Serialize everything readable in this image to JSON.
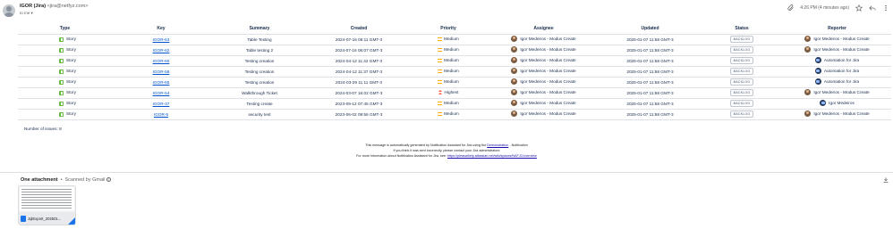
{
  "header": {
    "sender_name": "IGOR (Jira)",
    "sender_email": "<jira@netfyz.com>",
    "recipient": "to me",
    "timestamp": "4:26 PM (4 minutes ago)"
  },
  "table": {
    "columns": [
      "Type",
      "Key",
      "Summary",
      "Created",
      "Priority",
      "Assignee",
      "Updated",
      "Status",
      "Reporter"
    ],
    "rows": [
      {
        "type": "Story",
        "key": "IGOR-63",
        "summary": "Table Testing",
        "created": "2024-07-16 06:11 GMT-3",
        "priority": "Medium",
        "priority_level": "medium",
        "assignee": "Igor Medeiros - Modus Create",
        "updated": "2025-01-07 11:58 GMT-3",
        "status": "BACKLOG",
        "reporter": "Igor Medeiros - Modus Create",
        "reporter_kind": "person"
      },
      {
        "type": "Story",
        "key": "IGOR-62",
        "summary": "Table testing 2",
        "created": "2024-07-16 06:07 GMT-3",
        "priority": "Medium",
        "priority_level": "medium",
        "assignee": "Igor Medeiros - Modus Create",
        "updated": "2025-01-07 11:58 GMT-3",
        "status": "BACKLOG",
        "reporter": "Igor Medeiros - Modus Create",
        "reporter_kind": "person"
      },
      {
        "type": "Story",
        "key": "IGOR-60",
        "summary": "Testing creation",
        "created": "2024-04-12 11:42 GMT-3",
        "priority": "Medium",
        "priority_level": "medium",
        "assignee": "Igor Medeiros - Modus Create",
        "updated": "2025-01-07 11:58 GMT-3",
        "status": "BACKLOG",
        "reporter": "Automation for Jira",
        "reporter_kind": "bot"
      },
      {
        "type": "Story",
        "key": "IGOR-58",
        "summary": "Testing creation",
        "created": "2024-04-12 11:37 GMT-3",
        "priority": "Medium",
        "priority_level": "medium",
        "assignee": "Igor Medeiros - Modus Create",
        "updated": "2025-01-07 11:58 GMT-3",
        "status": "BACKLOG",
        "reporter": "Automation for Jira",
        "reporter_kind": "bot"
      },
      {
        "type": "Story",
        "key": "IGOR-55",
        "summary": "Testing creation",
        "created": "2024-03-29 11:11 GMT-3",
        "priority": "Medium",
        "priority_level": "medium",
        "assignee": "Igor Medeiros - Modus Create",
        "updated": "2025-01-07 11:58 GMT-3",
        "status": "BACKLOG",
        "reporter": "Automation for Jira",
        "reporter_kind": "bot"
      },
      {
        "type": "Story",
        "key": "IGOR-54",
        "summary": "Walkthrough Ticket",
        "created": "2024-03-07 16:02 GMT-3",
        "priority": "Highest",
        "priority_level": "high",
        "assignee": "Igor Medeiros - Modus Create",
        "updated": "2025-01-07 11:58 GMT-3",
        "status": "BACKLOG",
        "reporter": "Igor Medeiros - Modus Create",
        "reporter_kind": "person"
      },
      {
        "type": "Story",
        "key": "IGOR-37",
        "summary": "Testing create",
        "created": "2023-09-12 07:45 GMT-3",
        "priority": "Medium",
        "priority_level": "medium",
        "assignee": "Igor Medeiros - Modus Create",
        "updated": "2025-01-07 11:58 GMT-3",
        "status": "BACKLOG",
        "reporter": "Igor Medeiros",
        "reporter_kind": "bot"
      },
      {
        "type": "Story",
        "key": "IGOR-5",
        "summary": "security test",
        "created": "2023-06-02 09:56 GMT-3",
        "priority": "Medium",
        "priority_level": "medium",
        "assignee": "Igor Medeiros - Modus Create",
        "updated": "2025-01-07 11:58 GMT-3",
        "status": "BACKLOG",
        "reporter": "Igor Medeiros - Modus Create",
        "reporter_kind": "person"
      }
    ]
  },
  "issue_count": "Number of issues: 8",
  "notice": {
    "line1_prefix": "This message is automatically generated by Notification Assistant for Jira using the",
    "line1_link": "Demonstration",
    "line1_suffix": "- Notification",
    "line2": "If you think it was sent incorrectly, please contact your Jira administrators",
    "line3_prefix": "For more information about Notification Assistant for Jira, see:",
    "line3_link": "https://pleasalhelp.atlassian.net/wiki/spaces/NAFJC/overview"
  },
  "attachments": {
    "title": "One attachment",
    "separator": "•",
    "scan_text": "Scanned by Gmail",
    "file_name": "JqlExport_202501..."
  }
}
